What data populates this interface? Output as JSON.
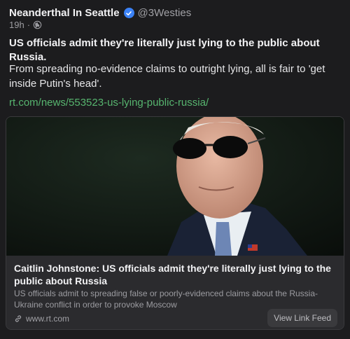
{
  "post": {
    "author": "Neanderthal In Seattle",
    "handle": "@3Westies",
    "time": "19h",
    "separator": "·",
    "headline": "US officials admit they're literally just lying to the public about Russia.",
    "body": "From spreading no-evidence claims to outright lying, all is fair to 'get inside Putin's head'.",
    "link": "rt.com/news/553523-us-lying-public-russia/"
  },
  "card": {
    "title": "Caitlin Johnstone: US officials admit they're literally just lying to the public about Russia",
    "description": "US officials admit to spreading false or poorly-evidenced claims about the Russia-Ukraine conflict in order to provoke Moscow",
    "domain": "www.rt.com",
    "button": "View Link Feed"
  },
  "icons": {
    "verified": "verified-badge-icon",
    "visibility": "globe-icon",
    "link": "link-icon"
  },
  "colors": {
    "background": "#1c1c1e",
    "link": "#57b56f",
    "verified": "#3b82f6"
  }
}
